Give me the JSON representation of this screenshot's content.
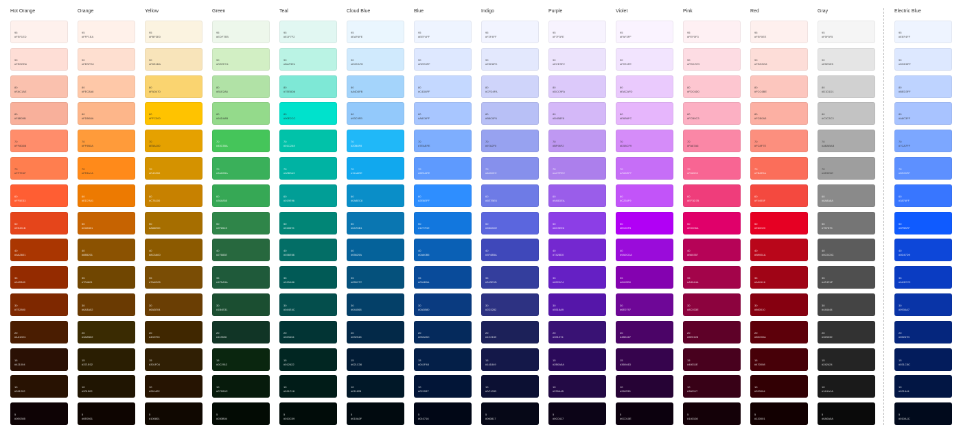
{
  "levels": [
    "95",
    "90",
    "80",
    "80",
    "70",
    "70",
    "60",
    "50",
    "40",
    "35",
    "30",
    "20",
    "15",
    "10",
    "5"
  ],
  "palettes": [
    {
      "name": "Hot Orange",
      "colors": [
        "#FEF1ED",
        "#FEDED6",
        "#FAC1AE",
        "#F8B09B",
        "#FF8D6B",
        "#FF7E4F",
        "#FF5E33",
        "#E5451B",
        "#AA3601",
        "#942B00",
        "#7E2800",
        "#4A1D01",
        "#2A1004",
        "#281202",
        "#0E0305"
      ]
    },
    {
      "name": "Orange",
      "colors": [
        "#FFF1EA",
        "#FEDFD0",
        "#FEC8A8",
        "#FDB68A",
        "#FF9B3A",
        "#FF8A1A",
        "#ED7A01",
        "#C66301",
        "#8B5201",
        "#704601",
        "#6A3A02",
        "#3A2B02",
        "#2A1E02",
        "#201502",
        "#0E0501"
      ]
    },
    {
      "name": "Yellow",
      "colors": [
        "#FBF3E0",
        "#F8E4BA",
        "#FAD470",
        "#FFC300",
        "#E5A100",
        "#D49200",
        "#C78100",
        "#A66E00",
        "#8C5A00",
        "#7A4D05",
        "#6A3E04",
        "#402700",
        "#301F04",
        "#261402",
        "#100801"
      ]
    },
    {
      "name": "Green",
      "colors": [
        "#EDF7EB",
        "#D2EFC4",
        "#B1E2A6",
        "#94DA8B",
        "#45C55A",
        "#3AB05A",
        "#36A855",
        "#2F8549",
        "#27683E",
        "#1F5A3A",
        "#1B4E31",
        "#113526",
        "#0A260F",
        "#071B0C",
        "#030B04"
      ]
    },
    {
      "name": "Teal",
      "colors": [
        "#E1F7F2",
        "#BAF3E4",
        "#7EE8D6",
        "#00E2CC",
        "#01C2A9",
        "#00B3A3",
        "#019E96",
        "#018576",
        "#036E66",
        "#015A56",
        "#044E4C",
        "#023434",
        "#012622",
        "#011C18",
        "#010C09"
      ]
    },
    {
      "name": "Cloud Blue",
      "colors": [
        "#EAF6FE",
        "#D0EAFD",
        "#A4D4FB",
        "#93C9FB",
        "#20B8F8",
        "#11A8EE",
        "#0A8EC8",
        "#0A76B1",
        "#05629A",
        "#05517C",
        "#044068",
        "#032948",
        "#021C36",
        "#011828",
        "#010A0F"
      ]
    },
    {
      "name": "Blue",
      "colors": [
        "#EEF4FF",
        "#DEE8FF",
        "#C4D8FF",
        "#A8C6FF",
        "#7EAEFE",
        "#5E9AFE",
        "#2E8EFF",
        "#1277DE",
        "#0A60B5",
        "#094B9A",
        "#0A3B80",
        "#052A5C",
        "#041F48",
        "#021537",
        "#010716"
      ]
    },
    {
      "name": "Indigo",
      "colors": [
        "#F2F4FF",
        "#E3E8FD",
        "#CFD4FA",
        "#B8C0F6",
        "#97A2F0",
        "#8690EC",
        "#6E7BE6",
        "#5B66DE",
        "#3F48BA",
        "#343E9D",
        "#2D3282",
        "#1C2159",
        "#141849",
        "#0C1033",
        "#060817"
      ]
    },
    {
      "name": "Purple",
      "colors": [
        "#F7F3FE",
        "#ECE3FC",
        "#DCC9FA",
        "#D4B8F8",
        "#BF98F2",
        "#AC7FEC",
        "#9A5DEA",
        "#8C3EE6",
        "#7428D0",
        "#6520C4",
        "#5516A9",
        "#391274",
        "#2B0A5A",
        "#230A45",
        "#0C0417"
      ]
    },
    {
      "name": "Violet",
      "colors": [
        "#FAF3FF",
        "#F2E4FE",
        "#EACAFD",
        "#E6B6FC",
        "#D58CF9",
        "#C66EF7",
        "#C254F9",
        "#B100F5",
        "#9A0CDA",
        "#8402B0",
        "#6E0797",
        "#4B0467",
        "#36044D",
        "#260335",
        "#0C010E"
      ]
    },
    {
      "name": "Pink",
      "colors": [
        "#FEF0F3",
        "#FDDCE3",
        "#FDC6D0",
        "#FCB0C3",
        "#FA87A6",
        "#F86593",
        "#EF3D7B",
        "#E0006A",
        "#B60357",
        "#A3044A",
        "#8C033E",
        "#5E0128",
        "#48011E",
        "#380117",
        "#140108"
      ]
    },
    {
      "name": "Red",
      "colors": [
        "#FEF0EE",
        "#FDDDD8",
        "#FCC6BE",
        "#FCB0A3",
        "#FC8F7E",
        "#FB6E5A",
        "#F4493F",
        "#E60023",
        "#B9061A",
        "#A00416",
        "#860010",
        "#5D000A",
        "#470008",
        "#320004",
        "#120001"
      ]
    },
    {
      "name": "Gray",
      "colors": [
        "#F5F5F5",
        "#E5E5E5",
        "#D1D1D1",
        "#C3C3C3",
        "#ABABAB",
        "#9E9E9E",
        "#8A8A8A",
        "#757575",
        "#5C5C5C",
        "#4F4F4F",
        "#444444",
        "#323232",
        "#242424",
        "#1A1A1A",
        "#0A0A0A"
      ]
    },
    {
      "name": "Electric Blue",
      "colors": [
        "#EEF4FF",
        "#DDE8FF",
        "#BED3FF",
        "#A8C3FF",
        "#7CA7FF",
        "#5D90FF",
        "#3876FF",
        "#0F5BFF",
        "#0D47D9",
        "#0A3CC2",
        "#0934A7",
        "#05267D",
        "#031C5C",
        "#021644",
        "#010A1C"
      ]
    }
  ],
  "hex_labels": [
    [
      "#FEF1ED",
      "#FEDED6",
      "#FAC1AE",
      "#F8B09B",
      "#FF8D6B",
      "#FF7E4F",
      "#FF5E33",
      "#E5451B",
      "#AA3601",
      "#942B00",
      "#7E2800",
      "#4A1D01",
      "#421004",
      "#281202",
      "#0E0305"
    ],
    [
      "#FFF1EA",
      "#FEDFD0",
      "#FEC8A8",
      "#FDB68A",
      "#FF9B3A",
      "#FF8A1A",
      "#ED7A01",
      "#C66301",
      "#8B5201",
      "#704601",
      "#6A3A02",
      "#3A2B02",
      "#371E02",
      "#201502",
      "#0E0501"
    ],
    [
      "#FBF3E0",
      "#F8E4BA",
      "#FAD470",
      "#FFC300",
      "#E5A100",
      "#D49200",
      "#C78100",
      "#A66E00",
      "#8C5A00",
      "#7A4D05",
      "#6A3E04",
      "#402700",
      "#301F04",
      "#261402",
      "#100801"
    ],
    [
      "#EDF7EB",
      "#D2EFC4",
      "#B1E2A6",
      "#94DA8B",
      "#45C55A",
      "#3AB05A",
      "#36A855",
      "#2F8549",
      "#27683E",
      "#1F5A3A",
      "#1B4E31",
      "#113526",
      "#0C2912",
      "#071B0C",
      "#030B04"
    ],
    [
      "#E1F7F2",
      "#BAF3E4",
      "#7EE8D6",
      "#00E2CC",
      "#01C2A9",
      "#00B3A3",
      "#019E96",
      "#018576",
      "#036E66",
      "#015A56",
      "#044E4C",
      "#023434",
      "#012622",
      "#011C18",
      "#010C09"
    ],
    [
      "#EAF6FE",
      "#D0EAFD",
      "#A4D4FB",
      "#93C9FB",
      "#20B8F8",
      "#11A8EE",
      "#0A8EC8",
      "#0A76B1",
      "#05629A",
      "#05517C",
      "#044068",
      "#032948",
      "#021C36",
      "#011828",
      "#010A0F"
    ],
    [
      "#EEF4FF",
      "#DEE8FF",
      "#C4D8FF",
      "#A8C6FF",
      "#7EAEFE",
      "#5E9AFE",
      "#2E8EFF",
      "#1277DE",
      "#0A60B5",
      "#094B9A",
      "#0A3B80",
      "#052A5C",
      "#041F48",
      "#021537",
      "#010716"
    ],
    [
      "#F2F4FF",
      "#E3E8FD",
      "#CFD4FA",
      "#B8C0F6",
      "#97A2F0",
      "#8690EC",
      "#6E7BE6",
      "#5B66DE",
      "#3F48BA",
      "#343E9D",
      "#2D3282",
      "#1C2159",
      "#141849",
      "#0C1033",
      "#060817"
    ],
    [
      "#F7F3FE",
      "#ECE3FC",
      "#DCC9FA",
      "#D4B8F8",
      "#BF98F2",
      "#AC7FEC",
      "#9A5DEA",
      "#8C3EE6",
      "#7428D0",
      "#6520C4",
      "#5516A9",
      "#391274",
      "#2B0A5A",
      "#230A45",
      "#0C0417"
    ],
    [
      "#FAF3FF",
      "#F2E4FE",
      "#EACAFD",
      "#E6B6FC",
      "#D58CF9",
      "#C66EF7",
      "#C254F9",
      "#B100F5",
      "#9A0CDA",
      "#8402B0",
      "#6E0797",
      "#4B0467",
      "#36044D",
      "#260335",
      "#0C010E"
    ],
    [
      "#FEF0F3",
      "#FDDCE3",
      "#FDC6D0",
      "#FCB0C3",
      "#FA87A6",
      "#F86593",
      "#EF3D7B",
      "#E0006A",
      "#B60357",
      "#A3044A",
      "#8C033E",
      "#5E0128",
      "#48011E",
      "#380117",
      "#140108"
    ],
    [
      "#FEF0EE",
      "#FDDDD8",
      "#FCC6BE",
      "#FCB0A3",
      "#FC8F7E",
      "#FB6E5A",
      "#F4493F",
      "#E60023",
      "#B9061A",
      "#A00416",
      "#860010",
      "#5D000A",
      "#470008",
      "#320004",
      "#120001"
    ],
    [
      "#F5F5F5",
      "#E5E5E5",
      "#D1D1D1",
      "#C3C3C3",
      "#ABABAB",
      "#9E9E9E",
      "#8A8A8A",
      "#757575",
      "#5C5C5C",
      "#4F4F4F",
      "#444444",
      "#323232",
      "#242424",
      "#1A1A1A",
      "#0A0A0A"
    ],
    [
      "#EEF4FF",
      "#DDE8FF",
      "#BED3FF",
      "#A8C3FF",
      "#7CA7FF",
      "#5D90FF",
      "#3876FF",
      "#0F5BFF",
      "#0D47D9",
      "#0A3CC2",
      "#0934A7",
      "#05267D",
      "#031C5C",
      "#021644",
      "#010A1C"
    ]
  ]
}
